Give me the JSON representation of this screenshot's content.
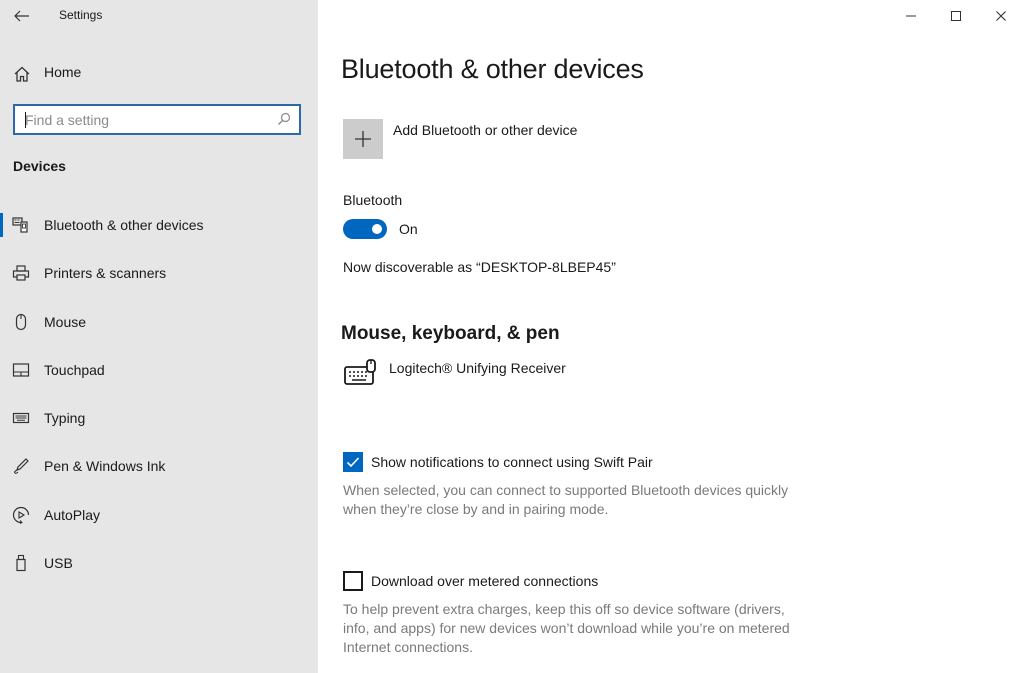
{
  "window": {
    "title": "Settings",
    "back_icon": "arrow-left-icon",
    "controls": {
      "minimize_icon": "minimize-icon",
      "maximize_icon": "maximize-icon",
      "close_icon": "close-icon"
    }
  },
  "sidebar": {
    "home_label": "Home",
    "search": {
      "placeholder": "Find a setting",
      "value": ""
    },
    "section_title": "Devices",
    "items": [
      {
        "label": "Bluetooth & other devices",
        "icon": "bluetooth-devices-icon",
        "selected": true
      },
      {
        "label": "Printers & scanners",
        "icon": "printer-icon",
        "selected": false
      },
      {
        "label": "Mouse",
        "icon": "mouse-icon",
        "selected": false
      },
      {
        "label": "Touchpad",
        "icon": "touchpad-icon",
        "selected": false
      },
      {
        "label": "Typing",
        "icon": "keyboard-icon",
        "selected": false
      },
      {
        "label": "Pen & Windows Ink",
        "icon": "pen-icon",
        "selected": false
      },
      {
        "label": "AutoPlay",
        "icon": "autoplay-icon",
        "selected": false
      },
      {
        "label": "USB",
        "icon": "usb-icon",
        "selected": false
      }
    ]
  },
  "main": {
    "title": "Bluetooth & other devices",
    "add_device_label": "Add Bluetooth or other device",
    "bluetooth": {
      "label": "Bluetooth",
      "state": true,
      "state_label": "On",
      "discoverable_text": "Now discoverable as “DESKTOP-8LBEP45”"
    },
    "mouse_keyboard_pen": {
      "title": "Mouse, keyboard, & pen",
      "devices": [
        {
          "name": "Logitech® Unifying Receiver",
          "icon": "keyboard-mouse-icon"
        }
      ]
    },
    "swift_pair": {
      "label": "Show notifications to connect using Swift Pair",
      "checked": true,
      "description": "When selected, you can connect to supported Bluetooth devices quickly when they’re close by and in pairing mode."
    },
    "metered": {
      "label": "Download over metered connections",
      "checked": false,
      "description": "To help prevent extra charges, keep this off so device software (drivers, info, and apps) for new devices won’t download while you’re on metered Internet connections."
    }
  },
  "colors": {
    "accent": "#0067c0",
    "sidebar_bg": "#e6e6e6",
    "description_text": "#7a7a7a"
  }
}
